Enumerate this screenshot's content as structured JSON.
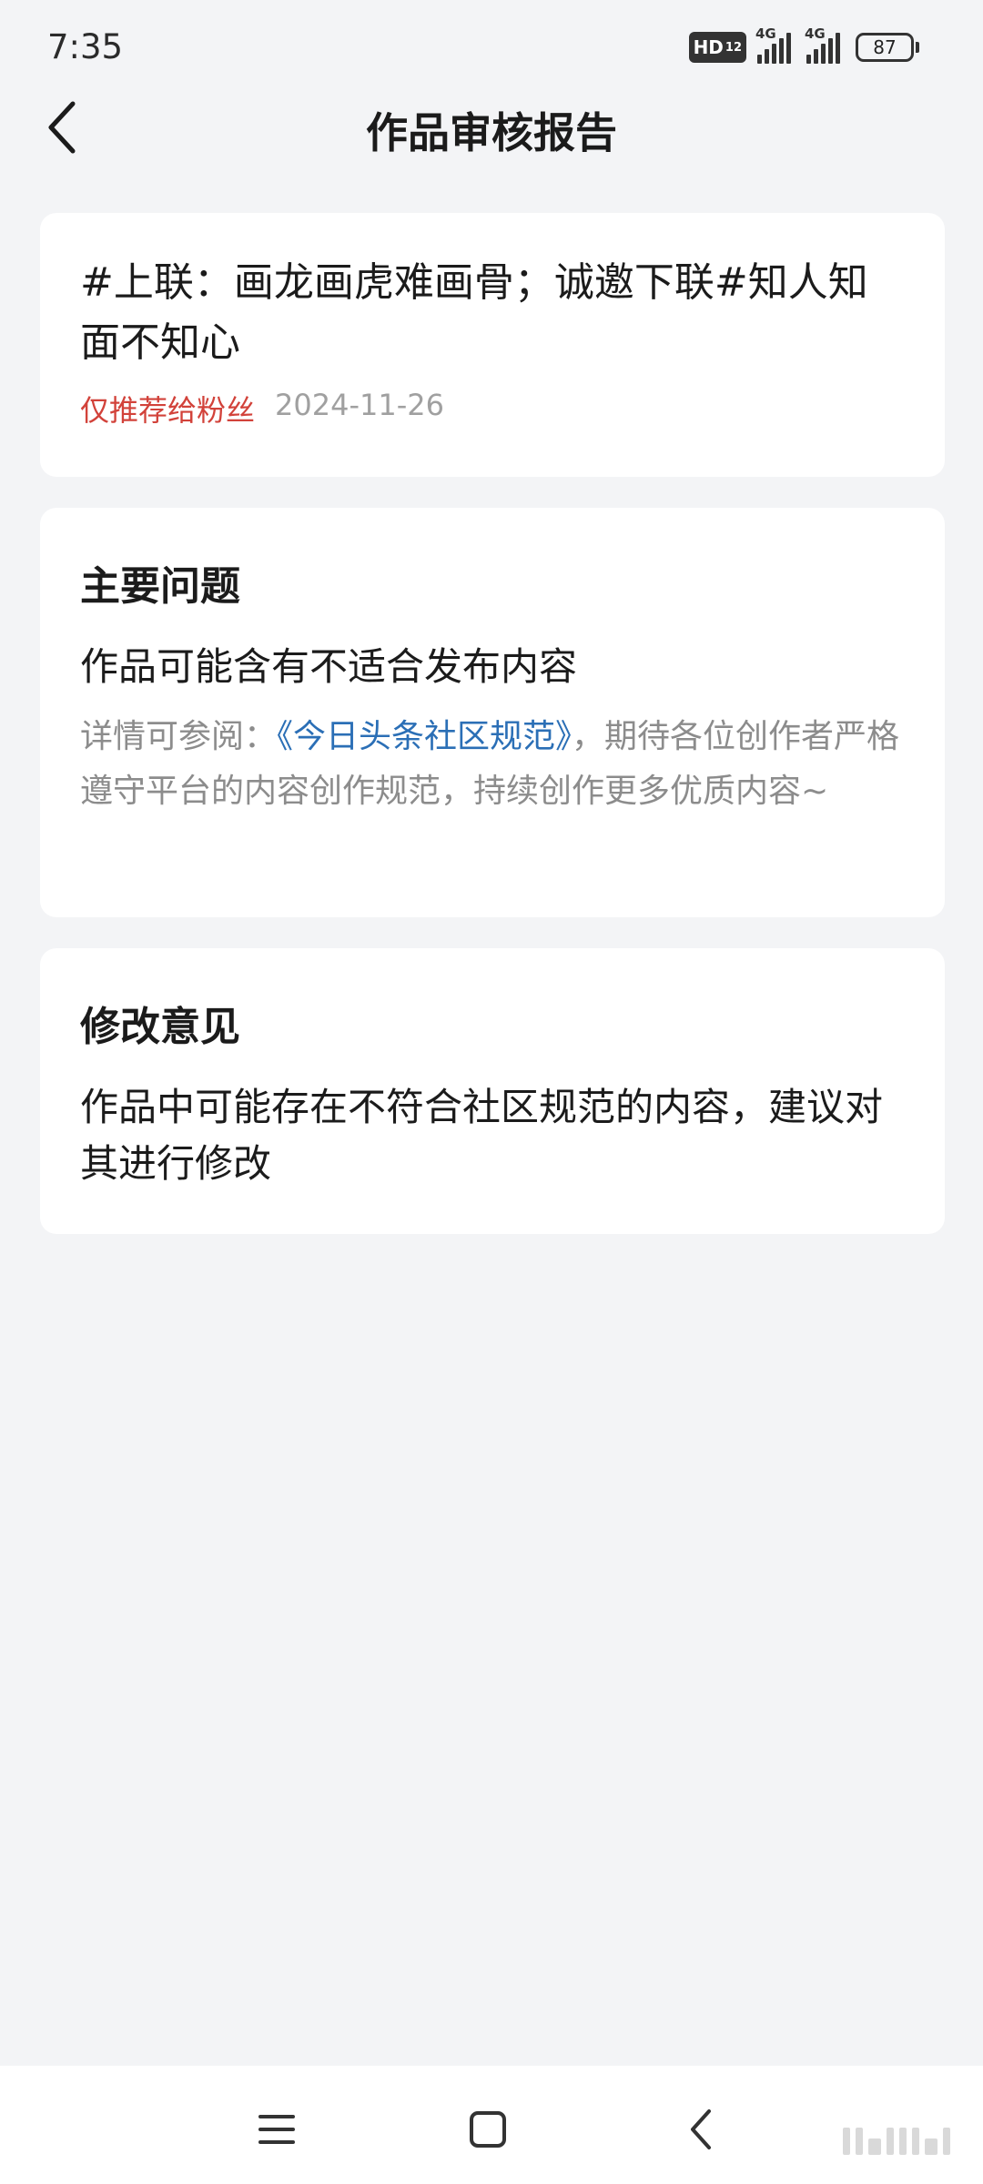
{
  "status_bar": {
    "time": "7:35",
    "network_1": "4G",
    "network_2": "4G",
    "hd_label": "HD",
    "hd_sub": "12",
    "battery": "87"
  },
  "nav": {
    "title": "作品审核报告",
    "back_icon": "chevron-left-icon"
  },
  "work": {
    "title": "#上联：画龙画虎难画骨；诚邀下联#知人知面不知心",
    "visibility": "仅推荐给粉丝",
    "date": "2024-11-26",
    "colors": {
      "visibility": "#d2423a",
      "date": "#a0a0a0"
    }
  },
  "main_issue": {
    "heading": "主要问题",
    "summary": "作品可能含有不适合发布内容",
    "detail_prefix": "详情可参阅：",
    "detail_link": "《今日头条社区规范》",
    "detail_suffix": "，期待各位创作者严格遵守平台的内容创作规范，持续创作更多优质内容~",
    "link_color": "#2b6fb6"
  },
  "suggestion": {
    "heading": "修改意见",
    "text": "作品中可能存在不符合社区规范的内容，建议对其进行修改"
  },
  "system_nav": {
    "menu_icon": "menu-icon",
    "home_icon": "home-square-icon",
    "back_icon": "back-chevron-icon"
  }
}
